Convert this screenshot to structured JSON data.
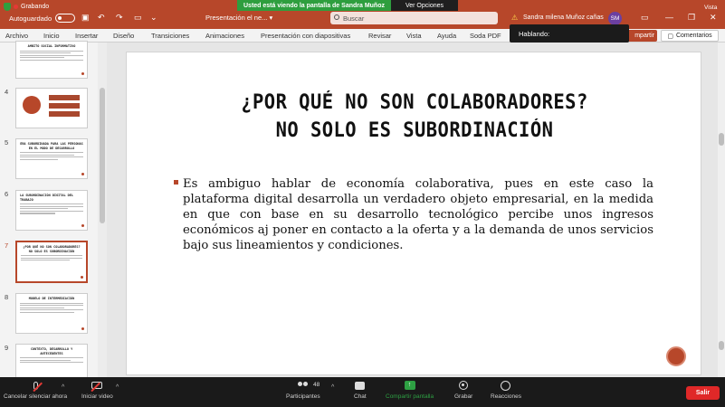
{
  "zoom": {
    "banner": "Usted está viendo la pantalla de Sandra Muñoz",
    "options": "Ver Opciones",
    "vista": "Vista",
    "speaking": "Hablando:"
  },
  "titlebar": {
    "recording": "Grabando",
    "autosave": "Autoguardado",
    "doc_title": "Presentación el ne... ▾",
    "search_placeholder": "Buscar",
    "user_name": "Sandra milena Muñoz cañas",
    "avatar_initials": "SM",
    "warning_glyph": "⚠"
  },
  "ribbon": {
    "tabs": [
      "Archivo",
      "Inicio",
      "Insertar",
      "Diseño",
      "Transiciones",
      "Animaciones",
      "Presentación con diapositivas",
      "Revisar",
      "Vista",
      "Ayuda",
      "Soda PDF"
    ],
    "share": "mpartir",
    "comments": "Comentarios"
  },
  "thumbnails": [
    {
      "num": "",
      "title": "AMBITO SOCIAL INFORMATIVO"
    },
    {
      "num": "4",
      "title": ""
    },
    {
      "num": "5",
      "title": "ERA SUBORDINADA PARA LAS PERSONAS EN EL MODO DE DESARROLLO"
    },
    {
      "num": "6",
      "title": "LA SUBORDINACIÓN DIGITAL DEL TRABAJO"
    },
    {
      "num": "7",
      "title": "¿POR QUÉ NO SON COLABORADORES? NO SOLO ES SUBORDINACIÓN"
    },
    {
      "num": "8",
      "title": "MODELO DE INTERMEDIACIÓN"
    },
    {
      "num": "9",
      "title": "CONTEXTO, DESARROLLO Y ANTECEDENTES"
    }
  ],
  "slide": {
    "title_line1": "¿POR QUÉ NO SON COLABORADORES?",
    "title_line2": "NO SOLO ES SUBORDINACIÓN",
    "body": "Es ambiguo hablar de economía colaborativa, pues en este caso la plataforma digital desarrolla un verdadero objeto empresarial, en la medida en que con base en su desarrollo tecnológico percibe unos ingresos económicos aj poner en contacto a la oferta y a la demanda de unos servicios bajo sus lineamientos y condiciones."
  },
  "toolbar": {
    "mute": "Cancelar silenciar ahora",
    "video": "Iniciar video",
    "participants": "Participantes",
    "participants_count": "48",
    "chat": "Chat",
    "share": "Compartir pantalla",
    "record": "Grabar",
    "reactions": "Reacciones",
    "leave": "Salir"
  }
}
